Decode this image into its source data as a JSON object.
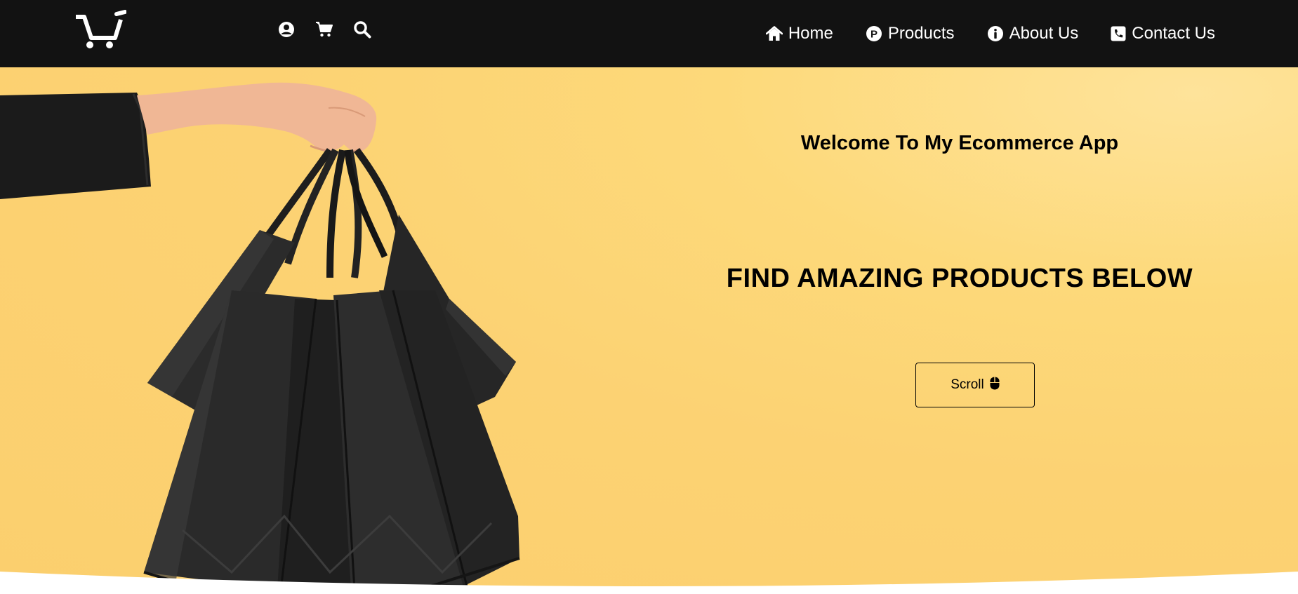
{
  "navbar": {
    "logo_icon": "shopping-cart-icon",
    "icons": [
      {
        "name": "user-icon"
      },
      {
        "name": "cart-icon"
      },
      {
        "name": "search-icon"
      }
    ],
    "links": [
      {
        "label": "Home",
        "icon": "home-icon"
      },
      {
        "label": "Products",
        "icon": "products-icon"
      },
      {
        "label": "About Us",
        "icon": "info-icon"
      },
      {
        "label": "Contact Us",
        "icon": "phone-icon"
      }
    ],
    "background": "#121212"
  },
  "hero": {
    "welcome": "Welcome To My Ecommerce App",
    "headline": "FIND AMAZING PRODUCTS BELOW",
    "scroll_label": "Scroll",
    "scroll_icon": "mouse-icon",
    "background": "#fcd273"
  }
}
